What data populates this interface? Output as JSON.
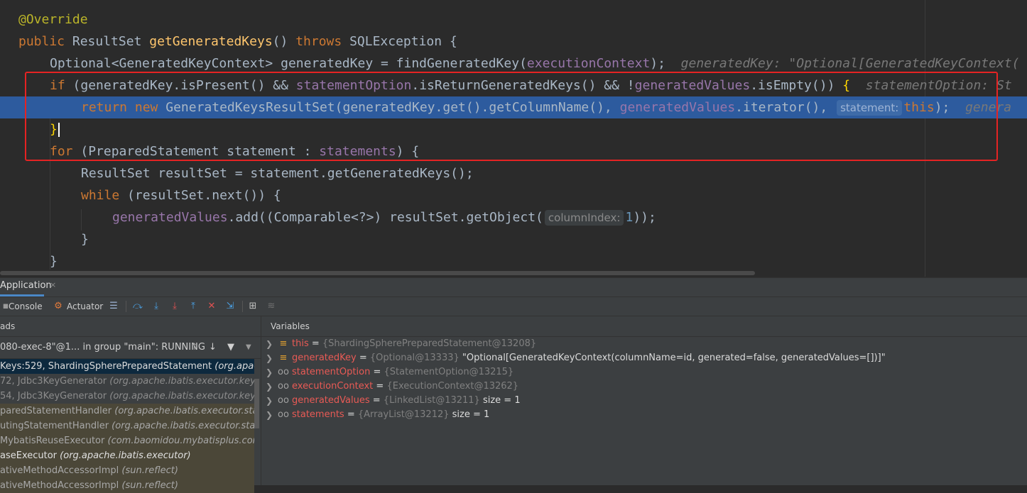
{
  "editor": {
    "annotation": "@Override",
    "method": {
      "kw_public": "public",
      "type": "ResultSet",
      "name": "getGeneratedKeys",
      "parens": "()",
      "kw_throws": "throws",
      "exception": "SQLException",
      "brace": "{"
    },
    "line3": {
      "decl": "Optional<GeneratedKeyContext> generatedKey = ",
      "call": "findGeneratedKey(",
      "arg": "executionContext",
      "end": ");",
      "hint": "generatedKey: \"Optional[GeneratedKeyContext("
    },
    "line4": {
      "kw_if": "if",
      "a": " (generatedKey.isPresent() && ",
      "f1": "statementOption",
      "b": ".isReturnGeneratedKeys() && !",
      "f2": "generatedValues",
      "c": ".isEmpty()) ",
      "brace": "{",
      "hint": "statementOption: St"
    },
    "line5": {
      "kw_return": "return",
      "kw_new": "new",
      "a": " GeneratedKeysResultSet(generatedKey.get().getColumnName(), ",
      "f": "generatedValues",
      "b": ".iterator(), ",
      "param": "statement:",
      "kw_this": "this",
      "end": ");",
      "hint": "genera"
    },
    "line6": {
      "brace": "}"
    },
    "line7": {
      "kw_for": "for",
      "a": " (PreparedStatement statement : ",
      "f": "statements",
      "b": ") {"
    },
    "line8": {
      "text": "ResultSet resultSet = statement.getGeneratedKeys();"
    },
    "line9": {
      "kw_while": "while",
      "text": " (resultSet.next()) {"
    },
    "line10": {
      "f": "generatedValues",
      "a": ".add((Comparable<?>) resultSet.getObject(",
      "param": "columnIndex:",
      "num": "1",
      "end": "));"
    },
    "line11": {
      "brace": "}"
    },
    "line12": {
      "brace": "}"
    }
  },
  "debug": {
    "tab_label": "Application",
    "tab_close": "×",
    "toolbar": {
      "console": "Console",
      "actuator": "Actuator"
    },
    "frames_header": "ads",
    "thread": {
      "text": "080-exec-8\"@1... in group \"main\": RUNNING"
    },
    "frames": [
      {
        "method": "Keys:529, ShardingSpherePreparedStatement ",
        "cls": "(org.apache.shard"
      },
      {
        "method": "72, Jdbc3KeyGenerator ",
        "cls": "(org.apache.ibatis.executor.keygen)"
      },
      {
        "method": "54, Jdbc3KeyGenerator ",
        "cls": "(org.apache.ibatis.executor.keygen)"
      },
      {
        "method": "paredStatementHandler ",
        "cls": "(org.apache.ibatis.executor.statement)"
      },
      {
        "method": "utingStatementHandler ",
        "cls": "(org.apache.ibatis.executor.statement)"
      },
      {
        "method": " MybatisReuseExecutor ",
        "cls": "(com.baomidou.mybatisplus.core.execu"
      },
      {
        "method": "aseExecutor ",
        "cls": "(org.apache.ibatis.executor)"
      },
      {
        "method": "ativeMethodAccessorImpl ",
        "cls": "(sun.reflect)"
      },
      {
        "method": "ativeMethodAccessorImpl ",
        "cls": "(sun.reflect)"
      }
    ],
    "variables_header": "Variables",
    "variables": [
      {
        "icon": "≡",
        "name": "this",
        "eq": " = ",
        "type": "{ShardingSpherePreparedStatement@13208}",
        "value": ""
      },
      {
        "icon": "≡",
        "name": "generatedKey",
        "eq": " = ",
        "type": "{Optional@13333}",
        "value": " \"Optional[GeneratedKeyContext(columnName=id, generated=false, generatedValues=[])]\""
      },
      {
        "icon": "oo",
        "name": "statementOption",
        "eq": " = ",
        "type": "{StatementOption@13215}",
        "value": ""
      },
      {
        "icon": "oo",
        "name": "executionContext",
        "eq": " = ",
        "type": "{ExecutionContext@13262}",
        "value": ""
      },
      {
        "icon": "oo",
        "name": "generatedValues",
        "eq": " = ",
        "type": "{LinkedList@13211}",
        "value": "  size = 1"
      },
      {
        "icon": "oo",
        "name": "statements",
        "eq": " = ",
        "type": "{ArrayList@13212}",
        "value": "  size = 1"
      }
    ],
    "colors": {
      "highlight": "#2d5b9e",
      "selection": "#0d293e",
      "error_box": "#e52323"
    }
  }
}
